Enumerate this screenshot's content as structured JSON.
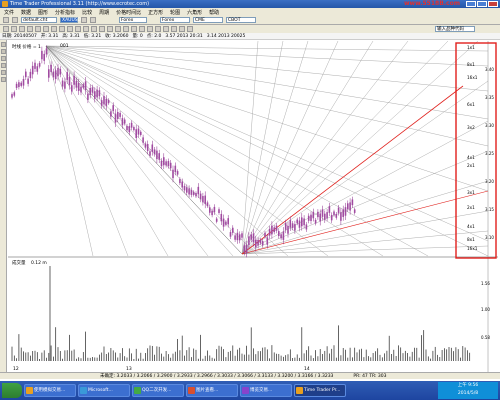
{
  "window": {
    "title": "Time Trader Professional 3.11 (http://www.ecrotec.com)",
    "logo": "www.5518B.com"
  },
  "menu": [
    "文件",
    "数据",
    "图形",
    "分析指标",
    "比较",
    "周期",
    "价格时间比",
    "正方形",
    "轮图",
    "六角形",
    "帮助"
  ],
  "toolbar": {
    "chart_select": "default.cht",
    "symbol_select": "XAUUSD",
    "data_select": "Forex",
    "exchange_select": "CME",
    "contract_select": "CBOT",
    "input_hint": "输入品种代码"
  },
  "infobar": {
    "fields": [
      "日期: 20140507",
      "开: 3.31",
      "高: 3.31",
      "低: 3.21",
      "收: 3.2060",
      "量: 0",
      "点: 2.0",
      "3.57 2013 20:31",
      "3.14 2013 20025"
    ]
  },
  "chart": {
    "header": "时线 价格 = 1",
    "top_marker": "001",
    "volume_label": "成交量",
    "volume_max": "0.12 m",
    "x_ticks": [
      "12",
      "13",
      "14"
    ],
    "gann_labels": [
      "1x1",
      "8x1",
      "16x1",
      "6x1",
      "3x2",
      "4x1",
      "2x1",
      "3x1",
      "2x1",
      "4x1",
      "8x1",
      "16x1"
    ],
    "price_ticks": [
      "3.40",
      "3.35",
      "3.30",
      "3.25",
      "3.20",
      "3.15",
      "3.10"
    ],
    "vol_ticks": [
      "1.56",
      "1.00",
      "0.58"
    ],
    "highlight_color": "#e0201c"
  },
  "statusbar": {
    "text": "未确定: 3.2033 / 3.2066 / 3.2900 / 3.2933 / 3.2966 / 3.3033 / 3.3066 / 3.3133 / 3.3200 / 3.3166 / 3.3233",
    "right": "PR: 47    TR: 303"
  },
  "taskbar": {
    "items": [
      "使用模拟交易...",
      "Microsoft...",
      "QQ二次开发...",
      "图片查看...",
      "博览交易...",
      "Time Trader Pr..."
    ],
    "clock_time": "上午 9:56",
    "clock_date": "2014/5/8"
  }
}
